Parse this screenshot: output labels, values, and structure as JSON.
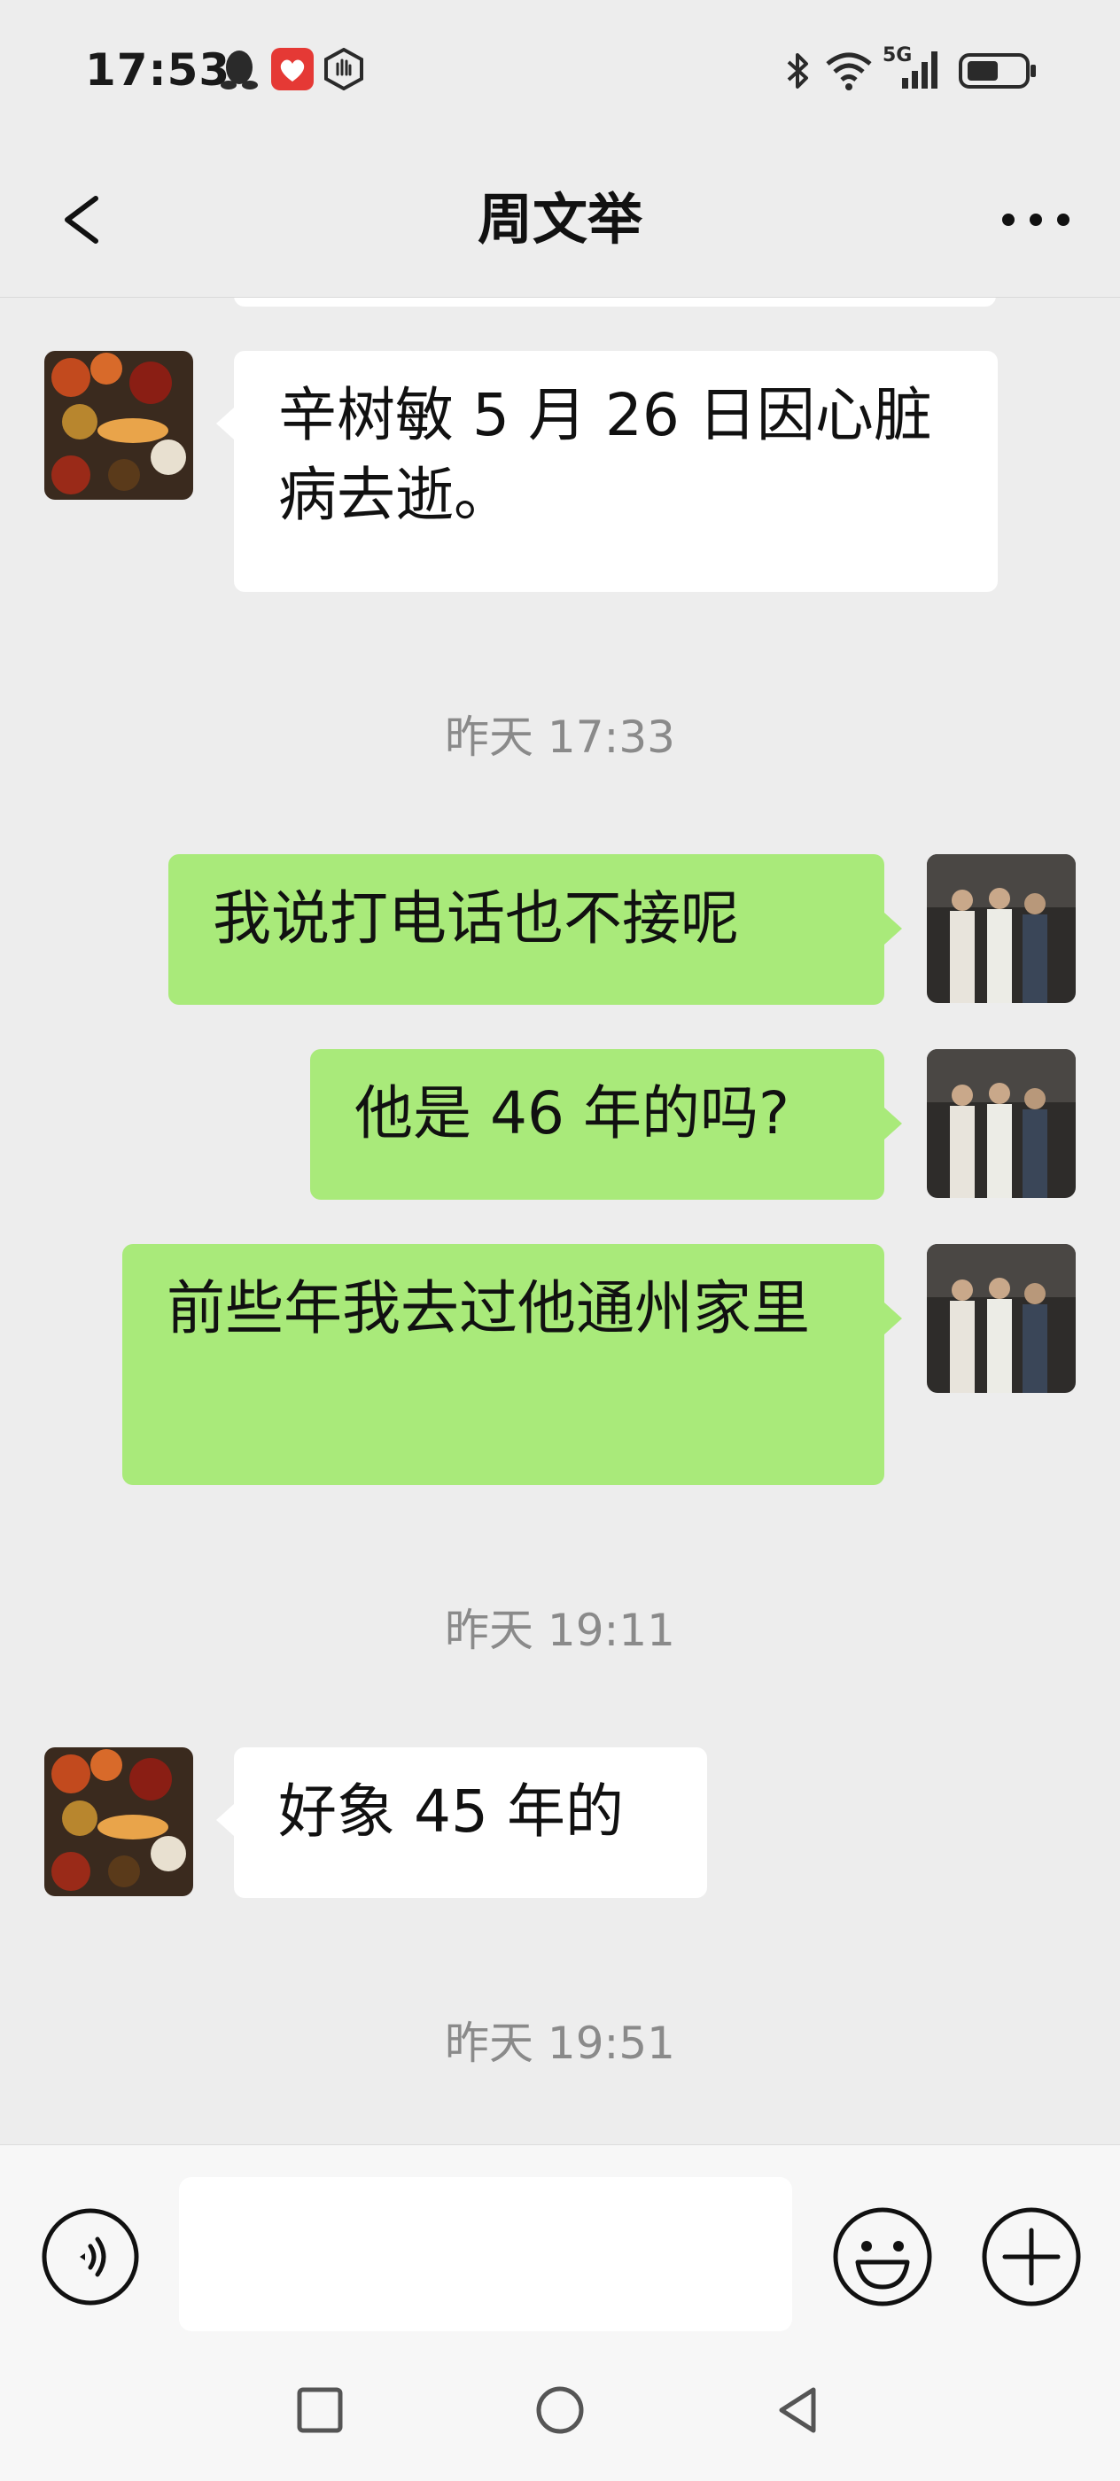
{
  "status_bar": {
    "time": "17:53",
    "icons": [
      "qq-icon",
      "app-heart-icon",
      "hand-icon",
      "bluetooth-icon",
      "wifi-icon",
      "signal-5g-icon",
      "battery-icon"
    ],
    "network_label": "5G"
  },
  "header": {
    "title": "周文举",
    "back_icon": "chevron-left-icon",
    "more_icon": "more-dots-icon"
  },
  "messages": [
    {
      "side": "in",
      "text": "辛树敏 5 月 26 日因心脏病去逝。"
    },
    {
      "type": "timestamp",
      "text": "昨天 17:33"
    },
    {
      "side": "out",
      "text": "我说打电话也不接呢"
    },
    {
      "side": "out",
      "text": "他是 46 年的吗?"
    },
    {
      "side": "out",
      "text": "前些年我去过他通州家里"
    },
    {
      "type": "timestamp",
      "text": "昨天 19:11"
    },
    {
      "side": "in",
      "text": "好象 45 年的"
    },
    {
      "type": "timestamp",
      "text": "昨天 19:51"
    }
  ],
  "input_bar": {
    "voice_icon": "voice-icon",
    "emoji_icon": "emoji-icon",
    "plus_icon": "plus-icon",
    "input_value": ""
  },
  "nav_bar": {
    "icons": [
      "recent-apps-icon",
      "home-icon",
      "back-triangle-icon"
    ]
  },
  "colors": {
    "background": "#ededed",
    "outgoing_bubble": "#a9ea7a",
    "incoming_bubble": "#ffffff",
    "timestamp": "#8a8a8a"
  }
}
